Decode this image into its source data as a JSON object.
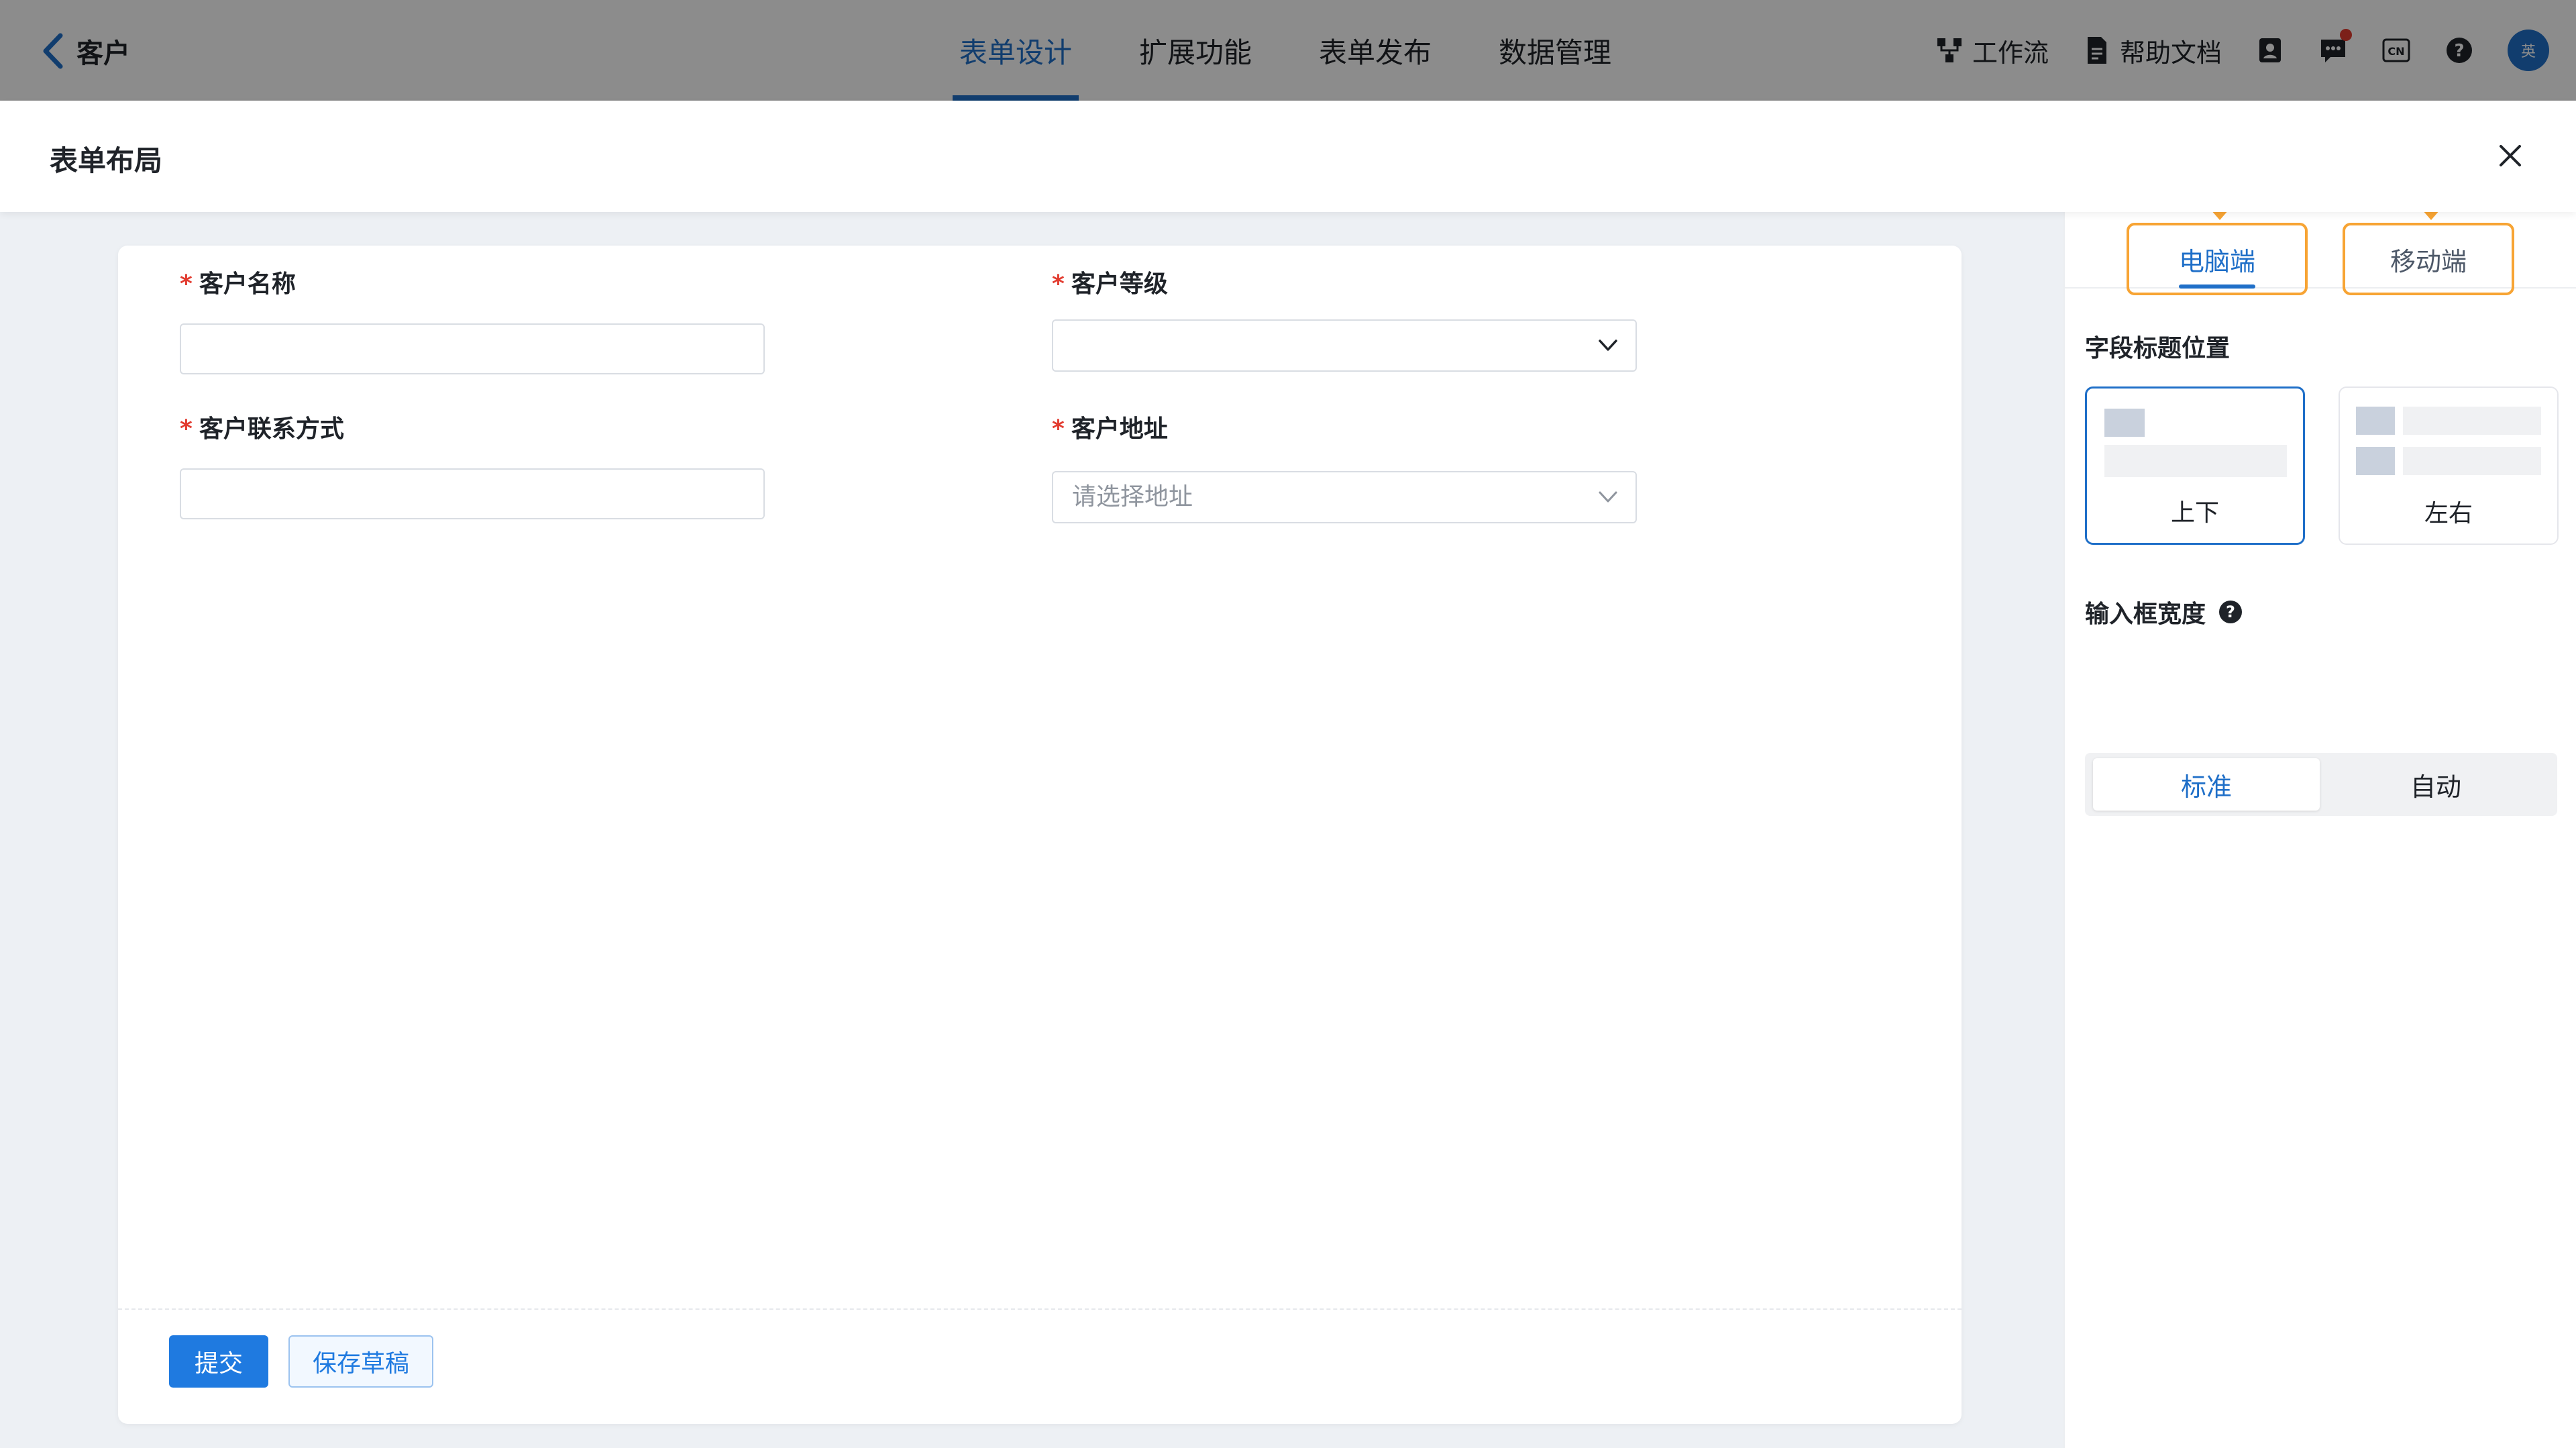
{
  "header": {
    "back_title": "客户",
    "tabs": [
      "表单设计",
      "扩展功能",
      "表单发布",
      "数据管理"
    ],
    "active_tab": 0,
    "tools": {
      "workflow": "工作流",
      "help_docs": "帮助文档",
      "lang": "CN",
      "avatar_text": "英"
    }
  },
  "drawer": {
    "title": "表单布局"
  },
  "form": {
    "fields": {
      "customer_name": {
        "label": "客户名称",
        "required": "*"
      },
      "customer_level": {
        "label": "客户等级",
        "required": "*"
      },
      "customer_contact": {
        "label": "客户联系方式",
        "required": "*"
      },
      "customer_address": {
        "label": "客户地址",
        "required": "*",
        "placeholder": "请选择地址"
      }
    },
    "submit_label": "提交",
    "draft_label": "保存草稿"
  },
  "side": {
    "device_tabs": [
      "电脑端",
      "移动端"
    ],
    "active_device": 0,
    "label_position_title": "字段标题位置",
    "label_position_options": [
      "上下",
      "左右"
    ],
    "label_position_selected": 0,
    "input_width_title": "输入框宽度",
    "input_width_help": "?",
    "input_width_options": [
      "标准",
      "自动"
    ],
    "input_width_selected": 0
  },
  "colors": {
    "accent": "#1f6fc8",
    "highlight": "#f7a434",
    "required": "#e23b2f"
  }
}
